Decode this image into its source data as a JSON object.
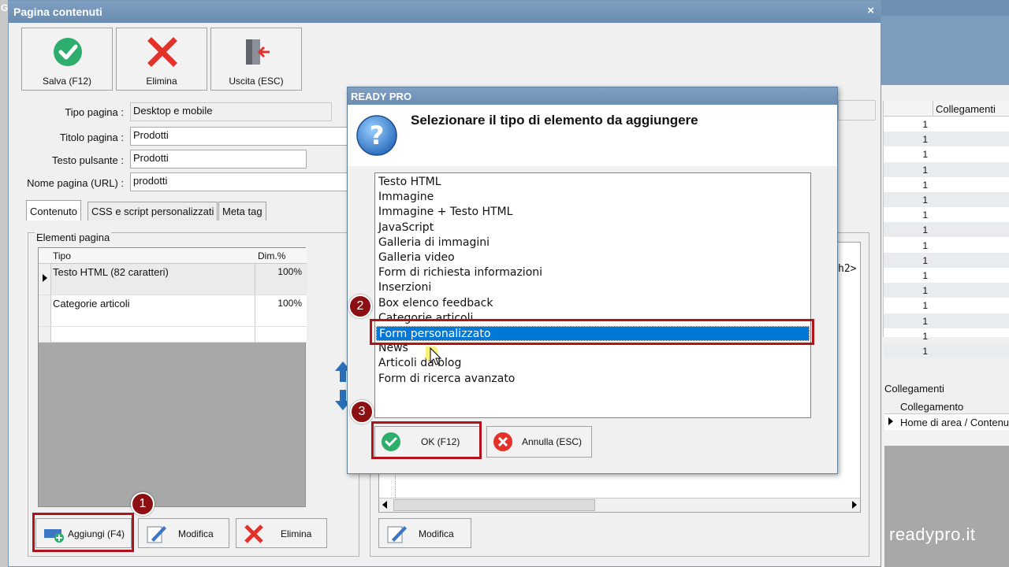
{
  "main_window": {
    "title": "Pagina contenuti",
    "close_glyph": "×",
    "edge_letter": "G"
  },
  "toolbar": {
    "save_label": "Salva (F12)",
    "delete_label": "Elimina",
    "exit_label": "Uscita (ESC)"
  },
  "form": {
    "page_type_label": "Tipo pagina :",
    "page_type_value": "Desktop e mobile",
    "page_title_label": "Titolo pagina :",
    "page_title_value": "Prodotti",
    "button_text_label": "Testo pulsante :",
    "button_text_value": "Prodotti",
    "page_name_label": "Nome pagina (URL) :",
    "page_name_value": "prodotti"
  },
  "tabs": [
    {
      "label": "Contenuto",
      "active": true
    },
    {
      "label": "CSS e script personalizzati",
      "active": false
    },
    {
      "label": "Meta tag",
      "active": false
    }
  ],
  "elements_panel": {
    "group_label": "Elementi pagina",
    "columns": [
      "Tipo",
      "Dim.%"
    ],
    "rows": [
      {
        "type": "Testo HTML (82 caratteri)",
        "dim": "100%"
      },
      {
        "type": "Categorie articoli",
        "dim": "100%"
      }
    ],
    "add_label": "Aggiungi (F4)",
    "edit_label": "Modifica",
    "delete_label": "Elimina"
  },
  "right_panel": {
    "code_fragment": "h2>",
    "edit_label": "Modifica"
  },
  "dialog": {
    "title": "READY PRO",
    "message": "Selezionare il tipo di elemento da aggiungere",
    "items": [
      "Testo HTML",
      "Immagine",
      "Immagine + Testo HTML",
      "JavaScript",
      "Galleria di immagini",
      "Galleria video",
      "Form di richiesta informazioni",
      "Inserzioni",
      "Box elenco feedback",
      "Categorie articoli",
      "Form personalizzato",
      "News",
      "Articoli da blog",
      "Form di ricerca avanzato"
    ],
    "selected_index": 10,
    "ok_label": "OK (F12)",
    "cancel_label": "Annulla (ESC)"
  },
  "background_window": {
    "links_column": "Collegamenti",
    "link_counts": [
      "1",
      "1",
      "1",
      "1",
      "1",
      "1",
      "1",
      "1",
      "1",
      "1",
      "1",
      "1",
      "1",
      "1",
      "1",
      "1"
    ],
    "links_group_label": "Collegamenti",
    "links_grid_header": "Collegamento",
    "links_grid_row": "Home di area / Contenuto"
  },
  "annotations": {
    "step1": "1",
    "step2": "2",
    "step3": "3"
  },
  "watermark": "readypro.it",
  "colors": {
    "highlight_red": "#b0131a",
    "badge_red": "#8c0f14",
    "selection_blue": "#0078d7",
    "titlebar_blue": "#6d8fb3"
  },
  "icons": [
    "check-icon",
    "cross-icon",
    "exit-door-icon",
    "add-element-icon",
    "edit-pencil-icon",
    "question-icon",
    "arrow-up-icon",
    "arrow-down-icon"
  ]
}
